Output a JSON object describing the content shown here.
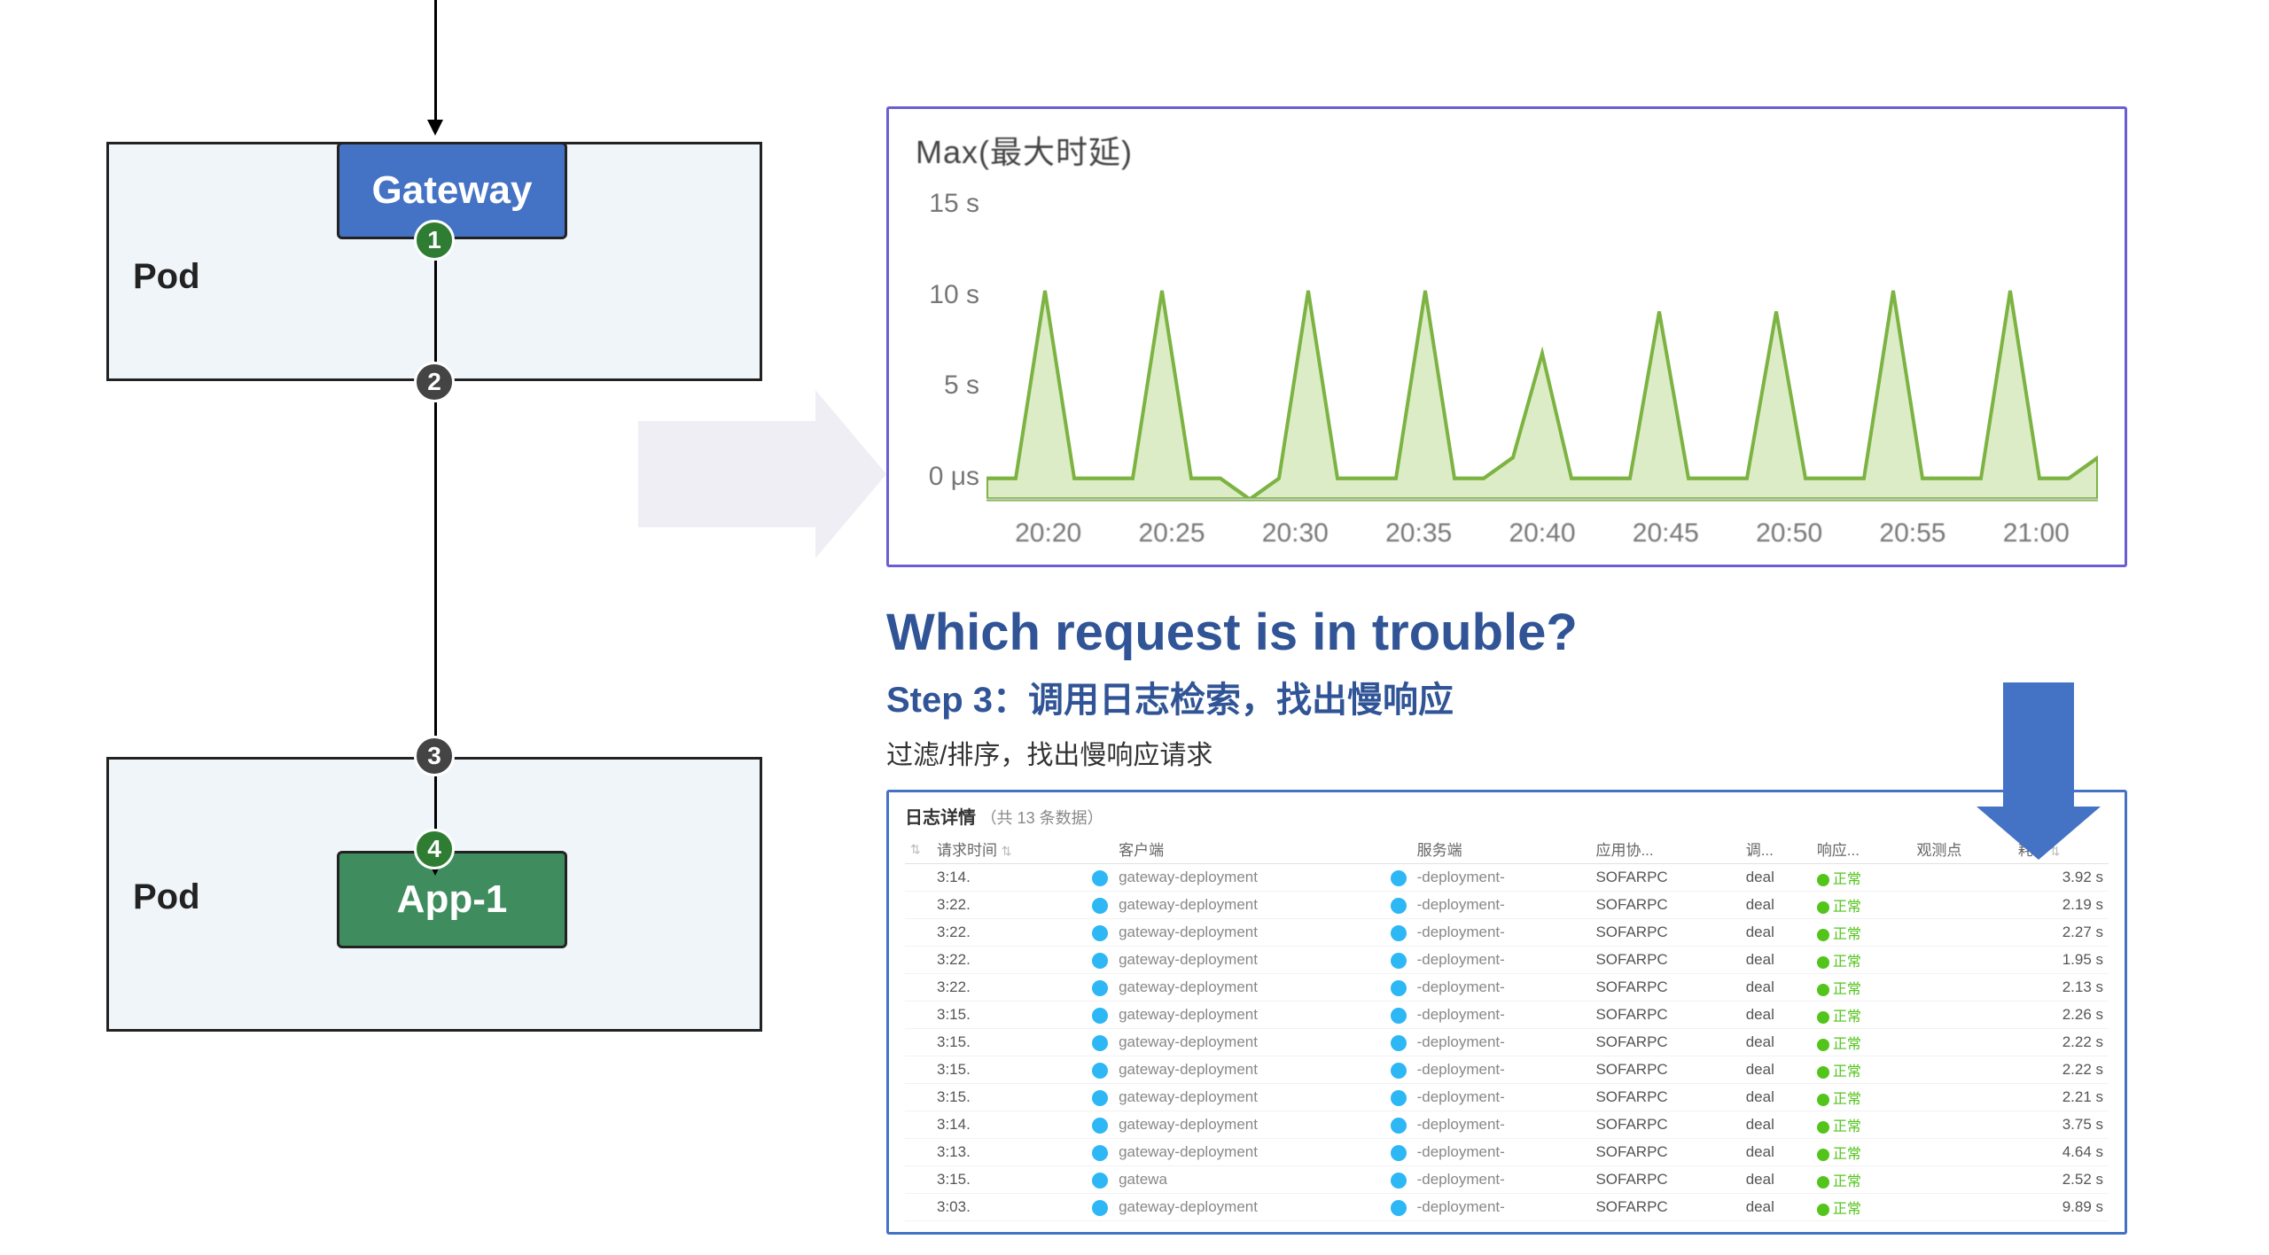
{
  "diagram": {
    "pod1_label": "Pod",
    "pod2_label": "Pod",
    "gateway_label": "Gateway",
    "app_label": "App-1",
    "step_nums": [
      "1",
      "2",
      "3",
      "4"
    ]
  },
  "titles": {
    "question": "Which request is in trouble?",
    "step": "Step 3：调用日志检索，找出慢响应",
    "sub": "过滤/排序，找出慢响应请求"
  },
  "chart_data": {
    "type": "area",
    "title": "Max(最大时延)",
    "yticks": [
      "15 s",
      "10 s",
      "5 s",
      "0 μs"
    ],
    "xticks": [
      "20:20",
      "20:25",
      "20:30",
      "20:35",
      "20:40",
      "20:45",
      "20:50",
      "20:55",
      "21:00"
    ],
    "ylim": [
      0,
      15
    ],
    "color": "#8bc34a",
    "series": [
      {
        "name": "max_latency",
        "values": [
          1,
          1,
          10,
          1,
          1,
          1,
          10,
          1,
          1,
          0,
          1,
          10,
          1,
          1,
          1,
          10,
          1,
          1,
          2,
          7,
          1,
          1,
          1,
          9,
          1,
          1,
          1,
          9,
          1,
          1,
          1,
          10,
          1,
          1,
          1,
          10,
          1,
          1,
          2
        ]
      }
    ]
  },
  "log": {
    "title": "日志详情",
    "count_label": "（共 13 条数据）",
    "columns": [
      "",
      "请求时间",
      "",
      "客户端",
      "",
      "服务端",
      "应用协...",
      "调...",
      "响应...",
      "观测点",
      "耗..."
    ],
    "rows": [
      {
        "time": "3:14.",
        "client": "gateway-deployment",
        "server": "-deployment-",
        "proto": "SOFARPC",
        "op": "deal",
        "status": "正常",
        "latency": "3.92 s"
      },
      {
        "time": "3:22.",
        "client": "gateway-deployment",
        "server": "-deployment-",
        "proto": "SOFARPC",
        "op": "deal",
        "status": "正常",
        "latency": "2.19 s"
      },
      {
        "time": "3:22.",
        "client": "gateway-deployment",
        "server": "-deployment-",
        "proto": "SOFARPC",
        "op": "deal",
        "status": "正常",
        "latency": "2.27 s"
      },
      {
        "time": "3:22.",
        "client": "gateway-deployment",
        "server": "-deployment-",
        "proto": "SOFARPC",
        "op": "deal",
        "status": "正常",
        "latency": "1.95 s"
      },
      {
        "time": "3:22.",
        "client": "gateway-deployment",
        "server": "-deployment-",
        "proto": "SOFARPC",
        "op": "deal",
        "status": "正常",
        "latency": "2.13 s"
      },
      {
        "time": "3:15.",
        "client": "gateway-deployment",
        "server": "-deployment-",
        "proto": "SOFARPC",
        "op": "deal",
        "status": "正常",
        "latency": "2.26 s"
      },
      {
        "time": "3:15.",
        "client": "gateway-deployment",
        "server": "-deployment-",
        "proto": "SOFARPC",
        "op": "deal",
        "status": "正常",
        "latency": "2.22 s"
      },
      {
        "time": "3:15.",
        "client": "gateway-deployment",
        "server": "-deployment-",
        "proto": "SOFARPC",
        "op": "deal",
        "status": "正常",
        "latency": "2.22 s"
      },
      {
        "time": "3:15.",
        "client": "gateway-deployment",
        "server": "-deployment-",
        "proto": "SOFARPC",
        "op": "deal",
        "status": "正常",
        "latency": "2.21 s"
      },
      {
        "time": "3:14.",
        "client": "gateway-deployment",
        "server": "-deployment-",
        "proto": "SOFARPC",
        "op": "deal",
        "status": "正常",
        "latency": "3.75 s"
      },
      {
        "time": "3:13.",
        "client": "gateway-deployment",
        "server": "-deployment-",
        "proto": "SOFARPC",
        "op": "deal",
        "status": "正常",
        "latency": "4.64 s"
      },
      {
        "time": "3:15.",
        "client": "gatewa",
        "server": "-deployment-",
        "proto": "SOFARPC",
        "op": "deal",
        "status": "正常",
        "latency": "2.52 s"
      },
      {
        "time": "3:03.",
        "client": "gateway-deployment",
        "server": "-deployment-",
        "proto": "SOFARPC",
        "op": "deal",
        "status": "正常",
        "latency": "9.89 s"
      }
    ]
  }
}
